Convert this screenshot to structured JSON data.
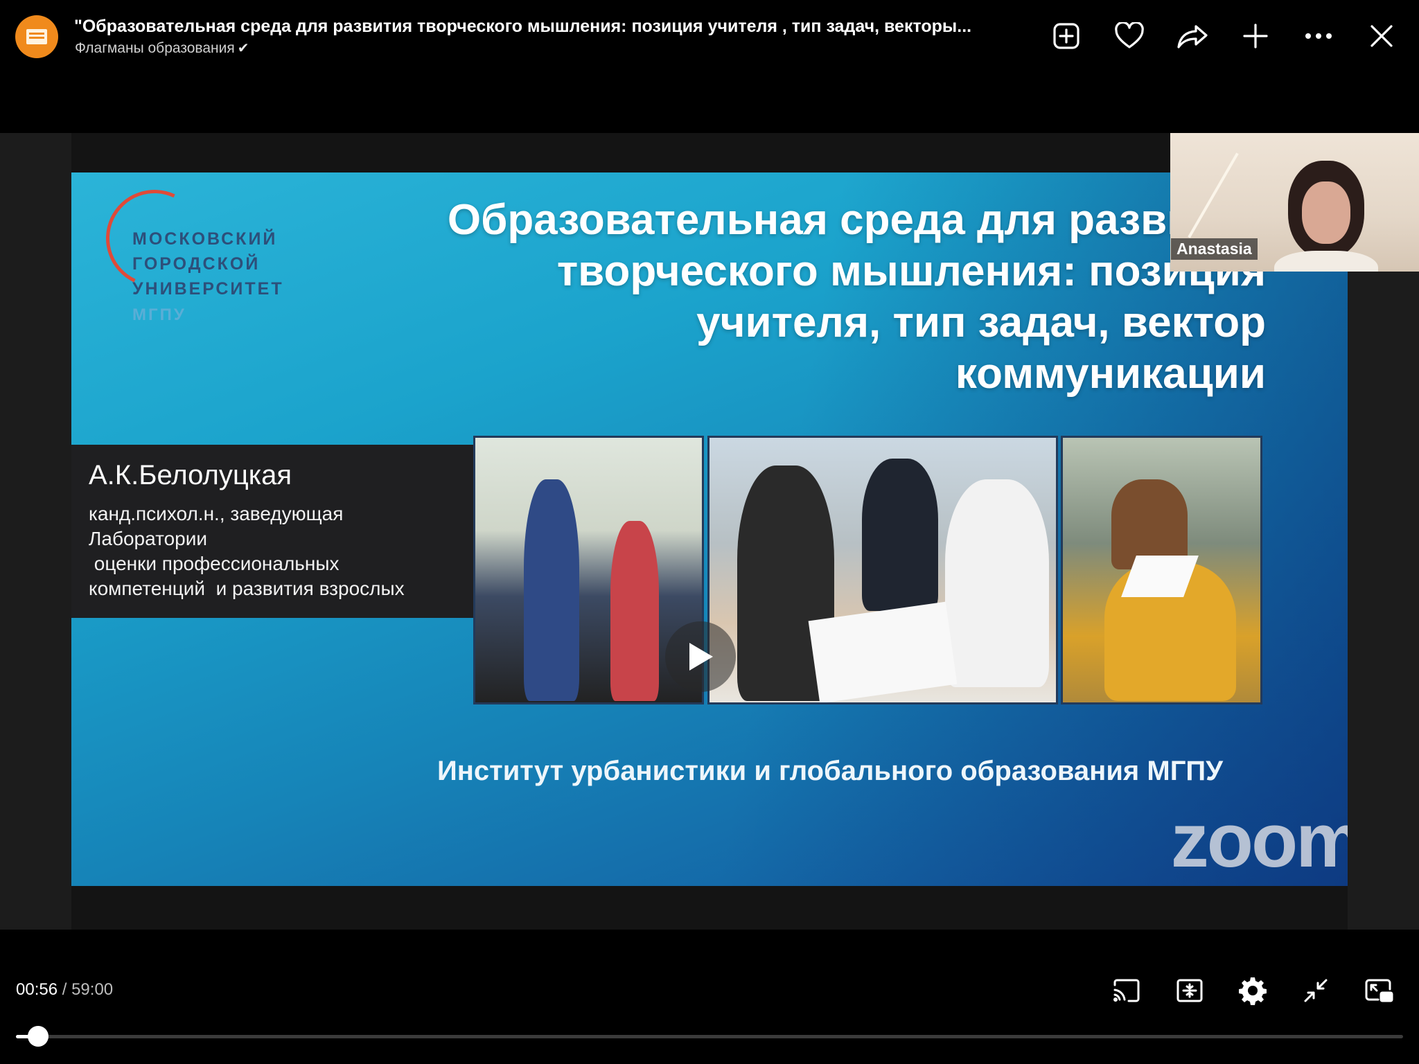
{
  "header": {
    "title": "\"Образовательная среда для развития творческого мышления: позиция учителя , тип задач, векторы...",
    "channel": "Флагманы образования",
    "verified_mark": "✔",
    "icons": [
      "add-to-playlist-icon",
      "like-icon",
      "share-icon",
      "add-icon",
      "more-icon",
      "close-icon"
    ]
  },
  "slide": {
    "logo_lines": [
      "МОСКОВСКИЙ",
      "ГОРОДСКОЙ",
      "УНИВЕРСИТЕТ"
    ],
    "logo_sub": "МГПУ",
    "title": "Образовательная среда для развития творческого мышления: позиция учителя, тип задач, вектор коммуникации",
    "author_name": "А.К.Белолуцкая",
    "author_role": "канд.психол.н., заведующая\nЛаборатории\n оценки профессиональных\nкомпетенций  и развития взрослых",
    "institute": "Институт урбанистики и глобального образования МГПУ",
    "watermark": "zoom",
    "participant_name": "Anastasia"
  },
  "player": {
    "current_time": "00:56",
    "separator": " / ",
    "duration": "59:00",
    "progress_fraction": 0.0158,
    "icons": [
      "cast-icon",
      "compact-mode-icon",
      "settings-icon",
      "exit-fullscreen-icon",
      "miniplayer-icon"
    ]
  },
  "colors": {
    "accent": "#f08a1c",
    "slide_blue": "#1ba3cc",
    "logo_red": "#e04a38"
  }
}
